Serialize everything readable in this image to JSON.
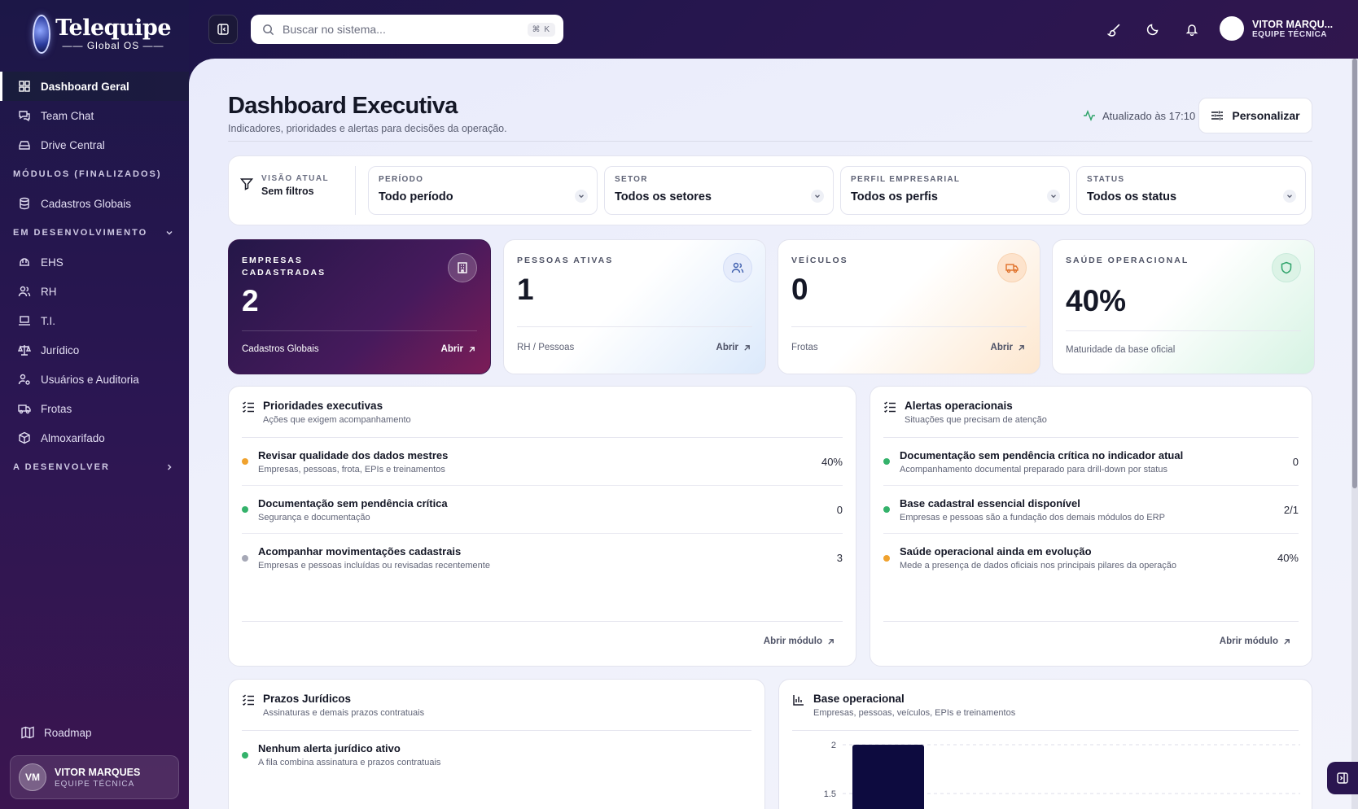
{
  "app": {
    "brand_name": "Telequipe",
    "brand_sub": "Global OS"
  },
  "sidebar": {
    "items_top": [
      {
        "label": "Dashboard Geral",
        "icon": "dashboard-icon",
        "active": true
      },
      {
        "label": "Team Chat",
        "icon": "chat-icon"
      },
      {
        "label": "Drive Central",
        "icon": "drive-icon"
      }
    ],
    "section_finalizados": "MÓDULOS (FINALIZADOS)",
    "items_finalizados": [
      {
        "label": "Cadastros Globais",
        "icon": "database-icon"
      }
    ],
    "section_dev": "EM DESENVOLVIMENTO",
    "items_dev": [
      {
        "label": "EHS",
        "icon": "hardhat-icon"
      },
      {
        "label": "RH",
        "icon": "users-icon"
      },
      {
        "label": "T.I.",
        "icon": "laptop-icon"
      },
      {
        "label": "Jurídico",
        "icon": "scale-icon"
      },
      {
        "label": "Usuários e Auditoria",
        "icon": "user-cog-icon"
      },
      {
        "label": "Frotas",
        "icon": "truck-icon"
      },
      {
        "label": "Almoxarifado",
        "icon": "box-icon"
      }
    ],
    "section_todo": "A DESENVOLVER",
    "roadmap": "Roadmap",
    "user": {
      "initials": "VM",
      "name": "VITOR MARQUES",
      "role": "EQUIPE TÉCNICA"
    }
  },
  "topbar": {
    "search_placeholder": "Buscar no sistema...",
    "search_shortcut": "⌘ K",
    "user_name": "VITOR MARQU...",
    "user_role": "EQUIPE TÉCNICA",
    "user_initials": "VM"
  },
  "page": {
    "title": "Dashboard Executiva",
    "subtitle": "Indicadores, prioridades e alertas para decisões da operação.",
    "updated": "Atualizado às 17:10",
    "customize": "Personalizar"
  },
  "filters": {
    "current_view_label": "VISÃO ATUAL",
    "current_view_value": "Sem filtros",
    "selects": [
      {
        "label": "PERÍODO",
        "value": "Todo período"
      },
      {
        "label": "SETOR",
        "value": "Todos os setores"
      },
      {
        "label": "PERFIL EMPRESARIAL",
        "value": "Todos os perfis"
      },
      {
        "label": "STATUS",
        "value": "Todos os status"
      }
    ]
  },
  "kpis": [
    {
      "label": "EMPRESAS CADASTRADAS",
      "value": "2",
      "footer": "Cadastros Globais",
      "open": "Abrir",
      "icon": "building-icon"
    },
    {
      "label": "PESSOAS ATIVAS",
      "value": "1",
      "footer": "RH / Pessoas",
      "open": "Abrir",
      "icon": "users-icon"
    },
    {
      "label": "VEÍCULOS",
      "value": "0",
      "footer": "Frotas",
      "open": "Abrir",
      "icon": "truck-icon"
    },
    {
      "label": "SAÚDE OPERACIONAL",
      "value": "40%",
      "footer": "Maturidade da base oficial",
      "icon": "shield-icon"
    }
  ],
  "priorities": {
    "title": "Prioridades executivas",
    "subtitle": "Ações que exigem acompanhamento",
    "rows": [
      {
        "title": "Revisar qualidade dos dados mestres",
        "sub": "Empresas, pessoas, frota, EPIs e treinamentos",
        "value": "40%",
        "color": "#f0a22e"
      },
      {
        "title": "Documentação sem pendência crítica",
        "sub": "Segurança e documentação",
        "value": "0",
        "color": "#34b26b"
      },
      {
        "title": "Acompanhar movimentações cadastrais",
        "sub": "Empresas e pessoas incluídas ou revisadas recentemente",
        "value": "3",
        "color": "#a6a8b6"
      }
    ],
    "footer": "Abrir módulo"
  },
  "alerts": {
    "title": "Alertas operacionais",
    "subtitle": "Situações que precisam de atenção",
    "rows": [
      {
        "title": "Documentação sem pendência crítica no indicador atual",
        "sub": "Acompanhamento documental preparado para drill-down por status",
        "value": "0",
        "color": "#34b26b"
      },
      {
        "title": "Base cadastral essencial disponível",
        "sub": "Empresas e pessoas são a fundação dos demais módulos do ERP",
        "value": "2/1",
        "color": "#34b26b"
      },
      {
        "title": "Saúde operacional ainda em evolução",
        "sub": "Mede a presença de dados oficiais nos principais pilares da operação",
        "value": "40%",
        "color": "#f0a22e"
      }
    ],
    "footer": "Abrir módulo"
  },
  "legal": {
    "title": "Prazos Jurídicos",
    "subtitle": "Assinaturas e demais prazos contratuais",
    "rows": [
      {
        "title": "Nenhum alerta jurídico ativo",
        "sub": "A fila combina assinatura e prazos contratuais",
        "color": "#34b26b"
      }
    ]
  },
  "base": {
    "title": "Base operacional",
    "subtitle": "Empresas, pessoas, veículos, EPIs e treinamentos"
  },
  "chart_data": {
    "type": "bar",
    "title": "Base operacional",
    "y_ticks": [
      "2",
      "1.5"
    ],
    "visible_bars": [
      2
    ],
    "ylim": [
      0,
      2
    ],
    "bar_color": "#0d0b3f"
  }
}
